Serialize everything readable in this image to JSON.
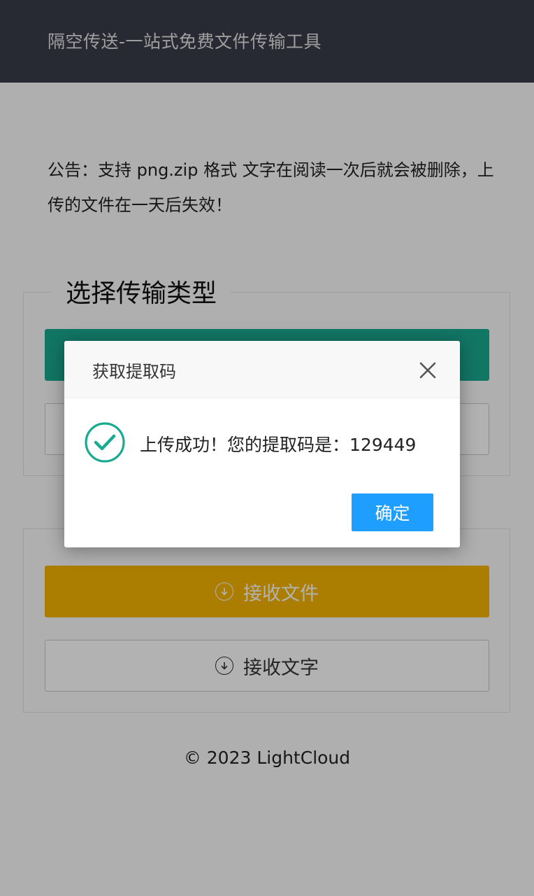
{
  "header": {
    "title": "隔空传送-一站式免费文件传输工具"
  },
  "notice": {
    "text": "公告：支持 png.zip 格式 文字在阅读一次后就会被删除，上传的文件在一天后失效！"
  },
  "send_section": {
    "legend": "选择传输类型"
  },
  "receive_section": {
    "receive_file_label": "接收文件",
    "receive_text_label": "接收文字"
  },
  "footer": {
    "text": "© 2023 LightCloud"
  },
  "modal": {
    "title": "获取提取码",
    "message": "上传成功！您的提取码是：129449",
    "ok_label": "确定"
  },
  "colors": {
    "header_bg": "#393d49",
    "send_file_button": "#1aaa91",
    "receive_file_button": "#f5b400",
    "ok_button": "#1e9fff",
    "success_icon": "#1aaa91"
  },
  "icons": {
    "close": "close-icon",
    "success": "check-circle-icon",
    "download": "download-circle-icon"
  }
}
